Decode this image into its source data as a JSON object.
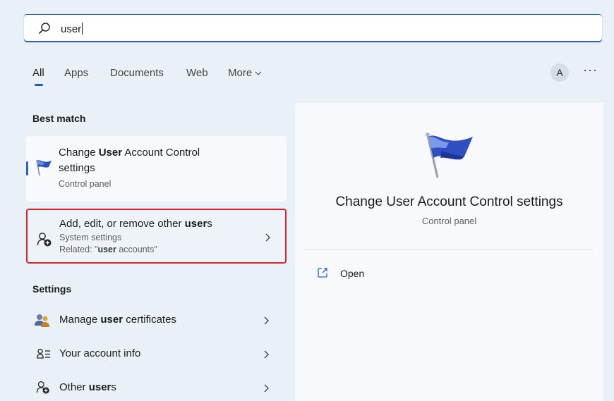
{
  "search": {
    "query": "user"
  },
  "tabs": [
    {
      "label": "All",
      "active": true
    },
    {
      "label": "Apps"
    },
    {
      "label": "Documents"
    },
    {
      "label": "Web"
    },
    {
      "label": "More"
    }
  ],
  "header": {
    "avatar_letter": "A",
    "more_label": "···"
  },
  "best_match": {
    "heading": "Best match",
    "item": {
      "title_pre": "Change ",
      "title_bold": "User",
      "title_post": " Account Control",
      "title_line2": "settings",
      "subtitle": "Control panel"
    }
  },
  "highlighted_item": {
    "title_pre": "Add, edit, or remove other ",
    "title_bold": "user",
    "title_post": "s",
    "subtitle": "System settings",
    "related_pre": "Related: \"",
    "related_bold": "user",
    "related_post": " accounts\""
  },
  "settings": {
    "heading": "Settings",
    "items": [
      {
        "pre": "Manage ",
        "bold": "user",
        "post": " certificates",
        "icon": "certificate-icon"
      },
      {
        "pre": "Your account info",
        "bold": "",
        "post": "",
        "icon": "account-info-icon"
      },
      {
        "pre": "Other ",
        "bold": "user",
        "post": "s",
        "icon": "add-user-icon"
      }
    ]
  },
  "preview": {
    "title": "Change User Account Control settings",
    "subtitle": "Control panel",
    "open_label": "Open"
  },
  "colors": {
    "accent": "#2a63b8",
    "highlight_border": "#d9252a"
  }
}
